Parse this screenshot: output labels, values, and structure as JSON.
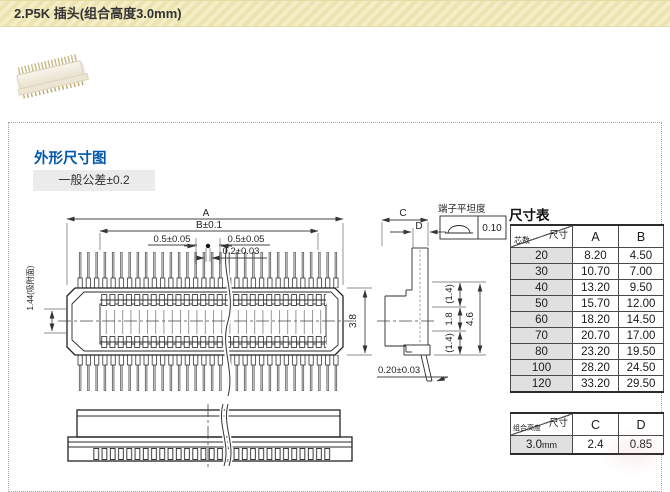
{
  "header": {
    "title": "2.P5K 插头(组合高度3.0mm)"
  },
  "section": {
    "title": "外形尺寸图",
    "tolerance_note": "一般公差±0.2",
    "accent_color": "#0057ad",
    "header_bg": "#f1ebbf"
  },
  "drawing": {
    "dims": {
      "a": "A",
      "b": "B±0.1",
      "pitch_left": "0.5±0.05",
      "pitch_right": "0.5±0.05",
      "center_gap": "0.2±0.03",
      "body_width": "3.8",
      "suction_face": "1.44(吸附面)",
      "c": "C",
      "d": "D",
      "flatness_label": "端子平坦度",
      "flatness_value": "0.10",
      "stack_top": "(1.4)",
      "stack_mid": "1.8",
      "stack_bot": "(1.4)",
      "stack_total": "4.6",
      "flange_thickness": "0.20±0.03"
    }
  },
  "size_table": {
    "title": "尺寸表",
    "corner_top": "尺寸",
    "corner_bottom": "芯数",
    "col_a": "A",
    "col_b": "B",
    "rows": [
      {
        "cores": "20",
        "a": "8.20",
        "b": "4.50"
      },
      {
        "cores": "30",
        "a": "10.70",
        "b": "7.00"
      },
      {
        "cores": "40",
        "a": "13.20",
        "b": "9.50"
      },
      {
        "cores": "50",
        "a": "15.70",
        "b": "12.00"
      },
      {
        "cores": "60",
        "a": "18.20",
        "b": "14.50"
      },
      {
        "cores": "70",
        "a": "20.70",
        "b": "17.00"
      },
      {
        "cores": "80",
        "a": "23.20",
        "b": "19.50"
      },
      {
        "cores": "100",
        "a": "28.20",
        "b": "24.50"
      },
      {
        "cores": "120",
        "a": "33.20",
        "b": "29.50"
      }
    ]
  },
  "height_table": {
    "corner_top": "尺寸",
    "corner_bottom": "组合高度",
    "col_c": "C",
    "col_d": "D",
    "row": {
      "height": "3.0",
      "unit": "mm",
      "c": "2.4",
      "d": "0.85"
    }
  }
}
